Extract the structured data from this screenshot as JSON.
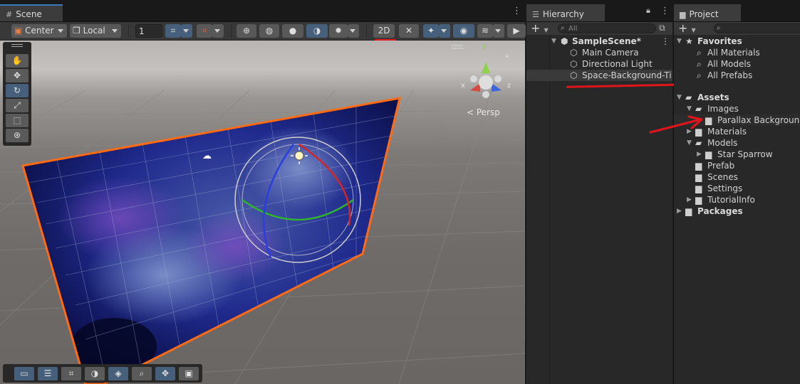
{
  "scene": {
    "tab_label": "Scene",
    "toolbar": {
      "pivot_label": "Center",
      "space_label": "Local",
      "grid_value": "1"
    },
    "view_label": "< Persp",
    "gizmo_axes": {
      "x": "x",
      "y": "y",
      "z": "z"
    }
  },
  "hierarchy": {
    "tab_label": "Hierarchy",
    "search_placeholder": "All",
    "scene_name": "SampleScene*",
    "items": [
      {
        "label": "Main Camera"
      },
      {
        "label": "Directional Light"
      },
      {
        "label": "Space-Background-Ti"
      }
    ]
  },
  "project": {
    "tab_label": "Project",
    "favorites_label": "Favorites",
    "favorites": [
      {
        "label": "All Materials"
      },
      {
        "label": "All Models"
      },
      {
        "label": "All Prefabs"
      }
    ],
    "assets_label": "Assets",
    "tree": [
      {
        "label": "Images"
      },
      {
        "label": "Parallax Background"
      },
      {
        "label": "Materials"
      },
      {
        "label": "Models"
      },
      {
        "label": "Star Sparrow"
      },
      {
        "label": "Prefab"
      },
      {
        "label": "Scenes"
      },
      {
        "label": "Settings"
      },
      {
        "label": "TutorialInfo"
      }
    ],
    "packages_label": "Packages"
  },
  "colors": {
    "accent": "#3a79bb",
    "selection": "#2c5d87",
    "annotation": "#e0151b",
    "outline": "#ff6a14"
  },
  "icons": [
    "grid-icon",
    "hand-icon",
    "move-icon",
    "rotate-icon",
    "scale-icon",
    "rect-icon",
    "transform-icon",
    "lock-icon",
    "menu-icon",
    "search-icon",
    "star-icon",
    "folder-icon",
    "gameobject-icon",
    "unity-scene-icon",
    "eye-icon",
    "gizmo-icon"
  ]
}
